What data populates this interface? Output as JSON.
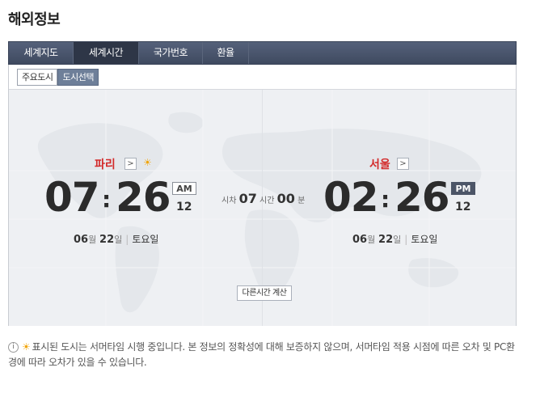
{
  "page": {
    "title": "해외정보"
  },
  "tabs": [
    {
      "label": "세계지도",
      "active": false
    },
    {
      "label": "세계시간",
      "active": true
    },
    {
      "label": "국가번호",
      "active": false
    },
    {
      "label": "환율",
      "active": false
    }
  ],
  "subtabs": [
    {
      "label": "주요도시",
      "active": false
    },
    {
      "label": "도시선택",
      "active": true
    }
  ],
  "left": {
    "city": "파리",
    "hour": "07",
    "colon": ":",
    "minute": "26",
    "ampm": "AM",
    "second": "12",
    "month": "06",
    "month_unit": "월",
    "day": "22",
    "day_unit": "일",
    "weekday": "토요일",
    "icon": "sun-icon"
  },
  "right": {
    "city": "서울",
    "hour": "02",
    "colon": ":",
    "minute": "26",
    "ampm": "PM",
    "second": "12",
    "month": "06",
    "month_unit": "월",
    "day": "22",
    "day_unit": "일",
    "weekday": "토요일"
  },
  "diff": {
    "prefix": "시차",
    "hours": "07",
    "hours_unit": "시간",
    "minutes": "00",
    "minutes_unit": "분"
  },
  "calc_button": "다른시간 계산",
  "notice": {
    "text": "표시된 도시는 서머타임 시행 중입니다. 본 정보의 정확성에 대해 보증하지 않으며, 서머타임 적용 시점에 따른 오차 및 PC환경에 따라 오차가 있을 수 있습니다."
  },
  "colors": {
    "accent_red": "#d32a2a",
    "tab_bg": "#4a556b",
    "pm_badge": "#4c5567"
  }
}
